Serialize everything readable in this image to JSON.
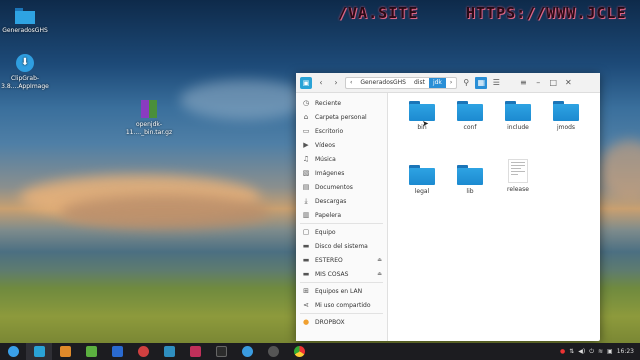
{
  "banner": {
    "left": "/VA.SITE",
    "right": "HTTPS://WWW.JCLE"
  },
  "desktop": {
    "icons": [
      {
        "label": "GeneradosGHS",
        "icon": "folder-icon"
      },
      {
        "label": "ClipGrab-3.8....AppImage",
        "icon": "download-icon"
      },
      {
        "label": "openjdk-11...._bin.tar.gz",
        "icon": "archive-icon"
      }
    ]
  },
  "window": {
    "breadcrumb": [
      "GeneradosGHS",
      "dist",
      "jdk"
    ],
    "controls": [
      "search-icon",
      "grid-view-icon",
      "list-view-icon",
      "menu-icon",
      "minimize-icon",
      "maximize-icon",
      "close-icon"
    ],
    "sidebar": [
      {
        "label": "Reciente",
        "icon": "clock-icon"
      },
      {
        "label": "Carpeta personal",
        "icon": "home-icon"
      },
      {
        "label": "Escritorio",
        "icon": "desktop-icon"
      },
      {
        "label": "Vídeos",
        "icon": "video-icon"
      },
      {
        "label": "Música",
        "icon": "music-icon"
      },
      {
        "label": "Imágenes",
        "icon": "image-icon"
      },
      {
        "label": "Documentos",
        "icon": "document-icon"
      },
      {
        "label": "Descargas",
        "icon": "download-icon"
      },
      {
        "label": "Papelera",
        "icon": "trash-icon"
      },
      {
        "label": "Equipo",
        "icon": "computer-icon"
      },
      {
        "label": "Disco del sistema",
        "icon": "drive-icon"
      },
      {
        "label": "ESTEREO",
        "icon": "drive-icon"
      },
      {
        "label": "MIS COSAS",
        "icon": "drive-icon"
      },
      {
        "label": "Equipos en LAN",
        "icon": "network-icon"
      },
      {
        "label": "Mi uso compartido",
        "icon": "share-icon"
      },
      {
        "label": "DROPBOX",
        "icon": "dropbox-icon"
      }
    ],
    "files": [
      {
        "label": "bin",
        "type": "folder"
      },
      {
        "label": "conf",
        "type": "folder"
      },
      {
        "label": "include",
        "type": "folder"
      },
      {
        "label": "jmods",
        "type": "folder"
      },
      {
        "label": "legal",
        "type": "folder"
      },
      {
        "label": "lib",
        "type": "folder"
      },
      {
        "label": "release",
        "type": "document"
      }
    ]
  },
  "taskbar": {
    "clock": "16:23"
  },
  "colors": {
    "accent": "#2a8fd6",
    "folder": "#2ea3e3"
  }
}
